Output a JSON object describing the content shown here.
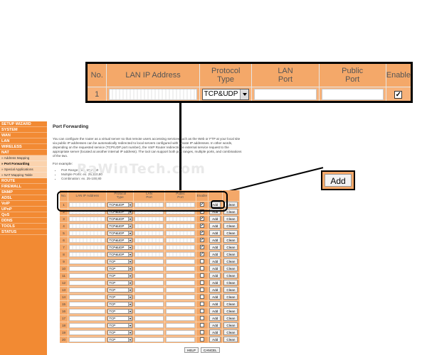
{
  "zoom_callout": {
    "headers": [
      "No.",
      "LAN IP Address",
      "Protocol Type",
      "LAN Port",
      "Public Port",
      "Enable"
    ],
    "row": {
      "no": "1",
      "protocol": "TCP&UDP",
      "enabled": true
    }
  },
  "add_callout": {
    "label": "Add"
  },
  "sidebar": {
    "items": [
      {
        "label": "SETUP WIZARD"
      },
      {
        "label": "SYSTEM"
      },
      {
        "label": "WAN"
      },
      {
        "label": "LAN"
      },
      {
        "label": "WIRELESS"
      },
      {
        "label": "NAT"
      }
    ],
    "sub_items": [
      {
        "label": "» Address Mapping",
        "active": false
      },
      {
        "label": "» Port Forwarding",
        "active": true
      },
      {
        "label": "» Special Applications",
        "active": false
      },
      {
        "label": "» NAT Mapping Table",
        "active": false
      }
    ],
    "items_after": [
      {
        "label": "ROUTE"
      },
      {
        "label": "FIREWALL"
      },
      {
        "label": "SNMP"
      },
      {
        "label": "ADSL"
      },
      {
        "label": "VoIP"
      },
      {
        "label": "UPnP"
      },
      {
        "label": "QoS"
      },
      {
        "label": "DDNS"
      },
      {
        "label": "TOOLS"
      },
      {
        "label": "STATUS"
      }
    ]
  },
  "main": {
    "title": "Port Forwarding",
    "description": "You can configure the router as a virtual server so that remote users accessing services such as the Web or FTP at your local site via public IP addresses can be automatically redirected to local servers configured with private IP addresses. In other words, depending on the requested service (TCP/UDP port number), the VoIP Router redirects the external service request to the appropriate server (located at another internal IP address). The tool can support both port ranges, multiple ports, and combinations of the two.",
    "example_title": "For example:",
    "examples": [
      "Port Ranges: ex. 100-150",
      "Multiple Ports: ex. 25,110,80",
      "Combination: ex. 25-100,80"
    ]
  },
  "watermark": "RaWinTech.com",
  "table": {
    "headers": [
      "No.",
      "LAN IP Address",
      "Protocol Type",
      "LAN Port",
      "Public Port",
      "Enable"
    ],
    "add_label": "Add",
    "clean_label": "Clean",
    "rows": [
      {
        "no": "1",
        "protocol": "TCP&UDP",
        "enabled": true
      },
      {
        "no": "2",
        "protocol": "TCP&UDP",
        "enabled": true
      },
      {
        "no": "3",
        "protocol": "TCP&UDP",
        "enabled": true
      },
      {
        "no": "4",
        "protocol": "TCP&UDP",
        "enabled": true
      },
      {
        "no": "5",
        "protocol": "TCP&UDP",
        "enabled": true
      },
      {
        "no": "6",
        "protocol": "TCP&UDP",
        "enabled": true
      },
      {
        "no": "7",
        "protocol": "TCP&UDP",
        "enabled": true
      },
      {
        "no": "8",
        "protocol": "TCP&UDP",
        "enabled": true
      },
      {
        "no": "9",
        "protocol": "TCP",
        "enabled": false
      },
      {
        "no": "10",
        "protocol": "TCP",
        "enabled": false
      },
      {
        "no": "11",
        "protocol": "TCP",
        "enabled": false
      },
      {
        "no": "12",
        "protocol": "TCP",
        "enabled": false
      },
      {
        "no": "13",
        "protocol": "TCP",
        "enabled": false
      },
      {
        "no": "14",
        "protocol": "TCP",
        "enabled": false
      },
      {
        "no": "15",
        "protocol": "TCP",
        "enabled": false
      },
      {
        "no": "16",
        "protocol": "TCP",
        "enabled": false
      },
      {
        "no": "17",
        "protocol": "TCP",
        "enabled": false
      },
      {
        "no": "18",
        "protocol": "TCP",
        "enabled": false
      },
      {
        "no": "19",
        "protocol": "TCP",
        "enabled": false
      },
      {
        "no": "20",
        "protocol": "TCP",
        "enabled": false
      }
    ]
  },
  "footer": {
    "help_label": "HELP",
    "cancel_label": "CANCEL"
  },
  "colors": {
    "sidebar": "#f28a33",
    "table": "#f4a869",
    "submenu": "#fbd3ae"
  }
}
